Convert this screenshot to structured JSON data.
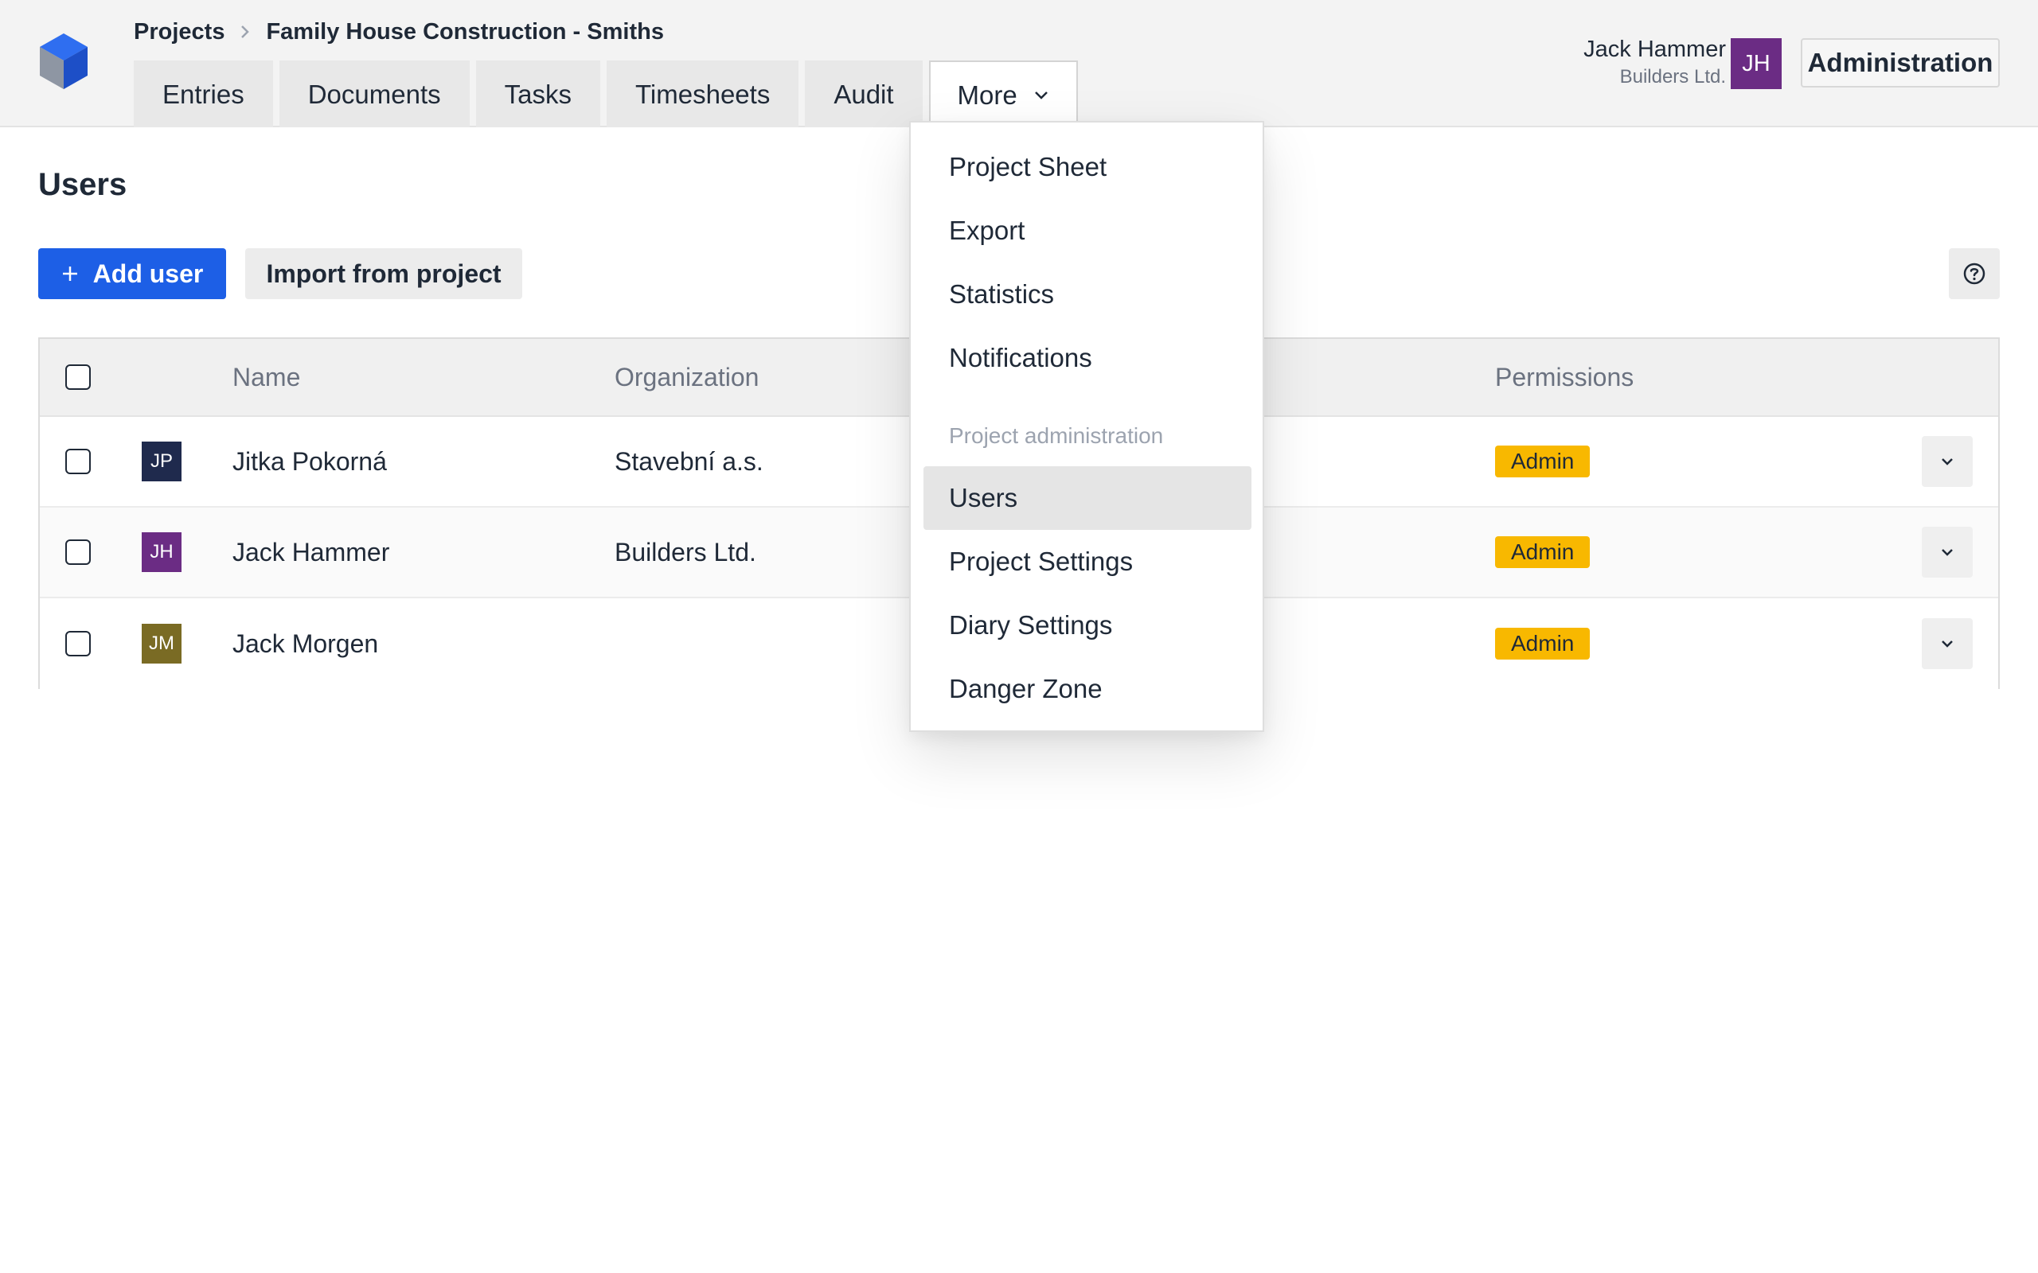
{
  "header": {
    "breadcrumb": {
      "root": "Projects",
      "current": "Family House Construction - Smiths"
    },
    "tabs": [
      {
        "label": "Entries"
      },
      {
        "label": "Documents"
      },
      {
        "label": "Tasks"
      },
      {
        "label": "Timesheets"
      },
      {
        "label": "Audit"
      },
      {
        "label": "More"
      }
    ],
    "user": {
      "name": "Jack Hammer",
      "org": "Builders Ltd.",
      "initials": "JH",
      "avatar_color": "#6b2c84"
    },
    "admin_label": "Administration"
  },
  "page": {
    "title": "Users",
    "add_user_label": "Add user",
    "import_label": "Import from project"
  },
  "table": {
    "columns": {
      "name": "Name",
      "organization": "Organization",
      "permissions": "Permissions"
    },
    "rows": [
      {
        "initials": "JP",
        "avatar_color": "#1f2a4d",
        "name": "Jitka Pokorná",
        "organization": "Stavební a.s.",
        "permission": "Admin"
      },
      {
        "initials": "JH",
        "avatar_color": "#6b2c84",
        "name": "Jack Hammer",
        "organization": "Builders Ltd.",
        "permission": "Admin"
      },
      {
        "initials": "JM",
        "avatar_color": "#7a6b24",
        "name": "Jack Morgen",
        "organization": "",
        "permission": "Admin"
      }
    ]
  },
  "more_menu": {
    "items": [
      {
        "label": "Project Sheet"
      },
      {
        "label": "Export"
      },
      {
        "label": "Statistics"
      },
      {
        "label": "Notifications"
      }
    ],
    "section_label": "Project administration",
    "admin_items": [
      {
        "label": "Users",
        "active": true
      },
      {
        "label": "Project Settings"
      },
      {
        "label": "Diary Settings"
      },
      {
        "label": "Danger Zone"
      }
    ]
  },
  "colors": {
    "primary": "#1d5fe6",
    "badge": "#f8b800",
    "topbar": "#f3f3f3"
  },
  "icons": {
    "logo": "cube-logo-icon",
    "breadcrumb_separator": "chevron-right-icon",
    "more_caret": "chevron-down-icon",
    "add": "plus-icon",
    "help": "question-circle-icon",
    "row_action": "chevron-down-icon"
  }
}
